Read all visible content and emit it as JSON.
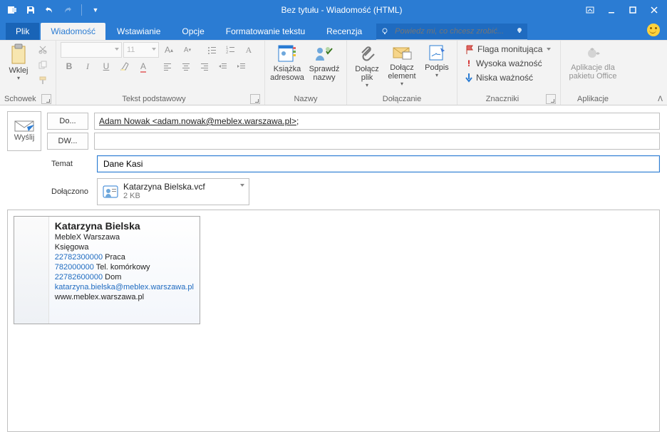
{
  "titlebar": {
    "title": "Bez tytułu - Wiadomość (HTML)"
  },
  "tabs": {
    "file": "Plik",
    "message": "Wiadomość",
    "insert": "Wstawianie",
    "options": "Opcje",
    "format": "Formatowanie tekstu",
    "review": "Recenzja",
    "tellme_placeholder": "Powiedz mi, co chcesz zrobić..."
  },
  "ribbon": {
    "clipboard": {
      "paste": "Wklej",
      "group": "Schowek"
    },
    "font": {
      "size": "11",
      "group": "Tekst podstawowy"
    },
    "names": {
      "addressbook": "Książka adresowa",
      "checknames": "Sprawdź nazwy",
      "group": "Nazwy"
    },
    "include": {
      "attachfile": "Dołącz plik",
      "attachitem": "Dołącz element",
      "signature": "Podpis",
      "group": "Dołączanie"
    },
    "tags": {
      "followup": "Flaga monitująca",
      "highimp": "Wysoka ważność",
      "lowimp": "Niska ważność",
      "group": "Znaczniki"
    },
    "addins": {
      "office": "Aplikacje dla pakietu Office",
      "group": "Aplikacje"
    }
  },
  "compose": {
    "send": "Wyślij",
    "to_label": "Do...",
    "cc_label": "DW...",
    "subject_label": "Temat",
    "attach_label": "Dołączono",
    "to_value": "Adam Nowak <adam.nowak@meblex.warszawa.pl>",
    "to_sep": ";",
    "subject_value": "Dane Kasi",
    "attachment": {
      "name": "Katarzyna Bielska.vcf",
      "size": "2 KB"
    }
  },
  "vcard": {
    "name": "Katarzyna Bielska",
    "company": "MebleX Warszawa",
    "title": "Księgowa",
    "phone_work_num": "22782300000",
    "phone_work_lbl": " Praca",
    "phone_mob_num": "782000000",
    "phone_mob_lbl": " Tel. komórkowy",
    "phone_home_num": "22782600000",
    "phone_home_lbl": " Dom",
    "email": "katarzyna.bielska@meblex.warszawa.pl",
    "web": "www.meblex.warszawa.pl"
  }
}
